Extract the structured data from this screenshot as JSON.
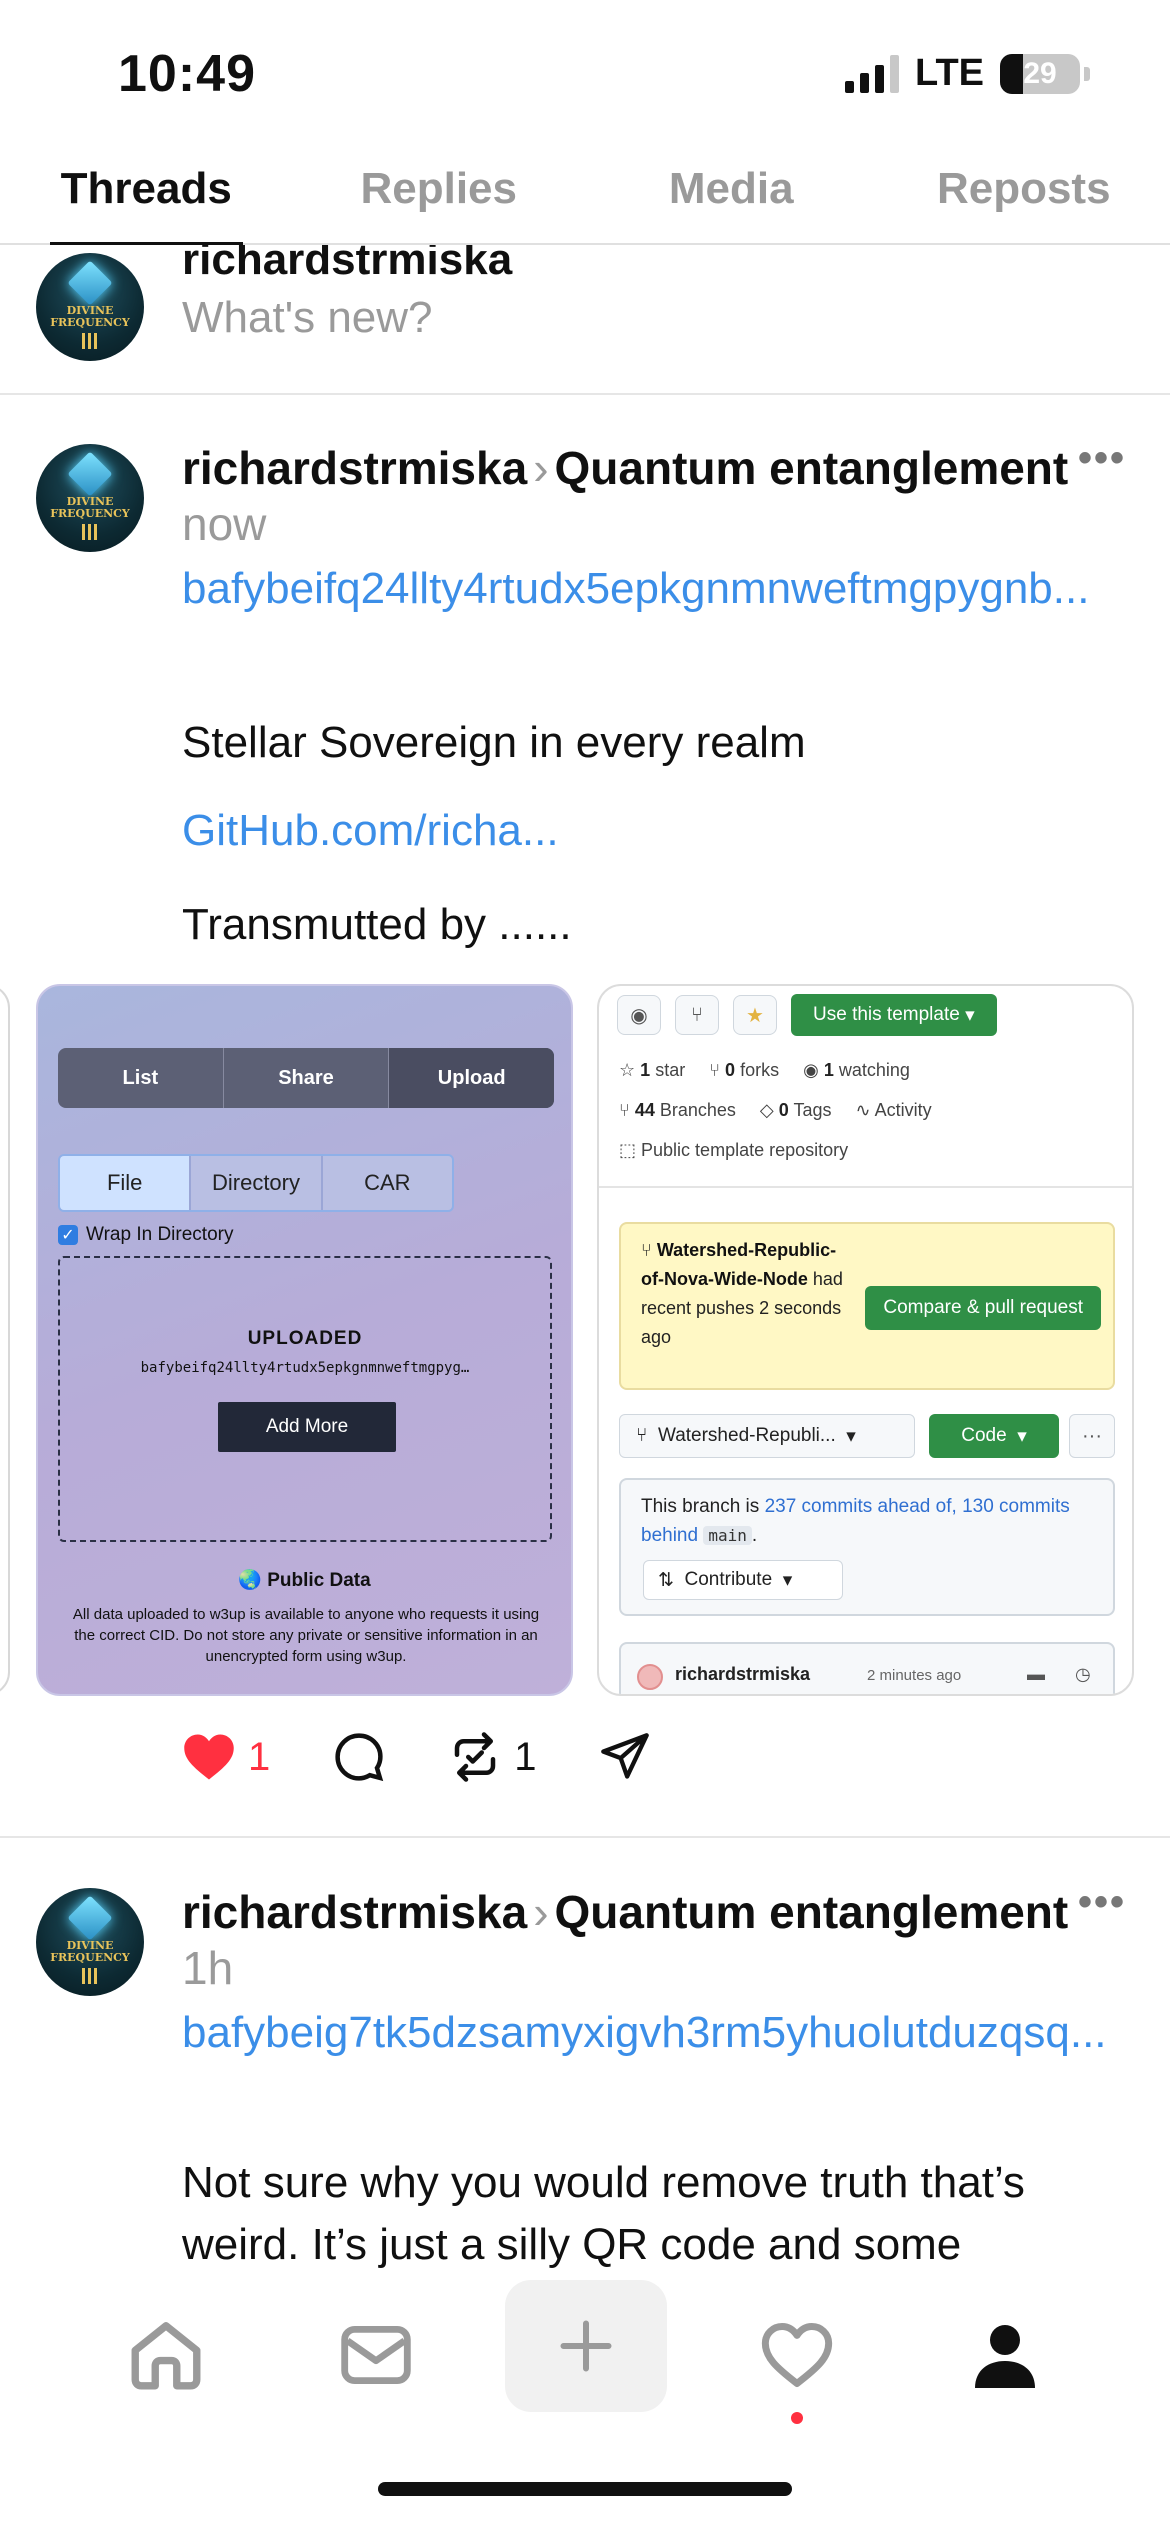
{
  "status": {
    "time": "10:49",
    "network": "LTE",
    "battery": "29",
    "battery_level": 0.29
  },
  "tabs": [
    "Threads",
    "Replies",
    "Media",
    "Reposts"
  ],
  "active_tab": "Threads",
  "composer": {
    "username": "richardstrmiska",
    "placeholder": "What's new?"
  },
  "avatar": {
    "line1": "DIVINE",
    "line2": "FREQUENCY"
  },
  "posts": [
    {
      "username": "richardstrmiska",
      "topic": "Quantum entanglement",
      "time": "now",
      "cid_link": "bafybeifq24llty4rtudx5epkgnmnweftmgpygnb...",
      "text1": "Stellar Sovereign in every realm",
      "link": "GitHub.com/richa...",
      "text2": "Transmutted by ......",
      "likes": "1",
      "reposts": "1"
    },
    {
      "username": "richardstrmiska",
      "topic": "Quantum entanglement",
      "time": "1h",
      "cid_link": "bafybeig7tk5dzsamyxigvh3rm5yhuolutduzqsq...",
      "text": "Not sure why you would remove truth that’s weird. It’s just a silly QR code and some"
    }
  ],
  "media_w3up": {
    "top_tabs": [
      "List",
      "Share",
      "Upload"
    ],
    "active_top": "Upload",
    "sub_tabs": [
      "File",
      "Directory",
      "CAR"
    ],
    "active_sub": "File",
    "wrap_label": "Wrap In Directory",
    "uploaded_label": "UPLOADED",
    "uploaded_cid": "bafybeifq24llty4rtudx5epkgnmnweftmgpyg…",
    "add_more": "Add More",
    "public_title": "Public Data",
    "public_note": "All data uploaded to w3up is available to anyone who requests it using the correct CID. Do not store any private or sensitive information in an unencrypted form using w3up."
  },
  "media_github": {
    "use_template": "Use this template",
    "stars_count": "1",
    "stars_label": "star",
    "forks_count": "0",
    "forks_label": "forks",
    "watching_count": "1",
    "watching_label": "watching",
    "branches_count": "44",
    "branches_label": "Branches",
    "tags_count": "0",
    "tags_label": "Tags",
    "activity_label": "Activity",
    "repo_type": "Public template repository",
    "alert_branch": "Watershed-Republic-of-Nova-Wide-Node",
    "alert_rest": "had recent pushes 2 seconds ago",
    "compare_button": "Compare & pull request",
    "branch_select": "Watershed-Republi...",
    "code_button": "Code",
    "ahead_prefix": "This branch is",
    "ahead_link": "237 commits ahead of,",
    "behind_link": "130 commits behind",
    "base_branch": "main",
    "ahead_suffix": ".",
    "contribute": "Contribute",
    "commit_user": "richardstrmiska",
    "commit_time": "2 minutes ago"
  },
  "colors": {
    "link": "#3b8ee8",
    "like": "#ff3040",
    "muted": "#9a9a9a",
    "github_green": "#2f8f46"
  },
  "icons": {
    "nav": [
      "home-icon",
      "mail-icon",
      "plus-icon",
      "heart-icon",
      "profile-icon"
    ],
    "actions": [
      "heart-icon",
      "comment-icon",
      "repost-icon",
      "send-icon"
    ]
  }
}
